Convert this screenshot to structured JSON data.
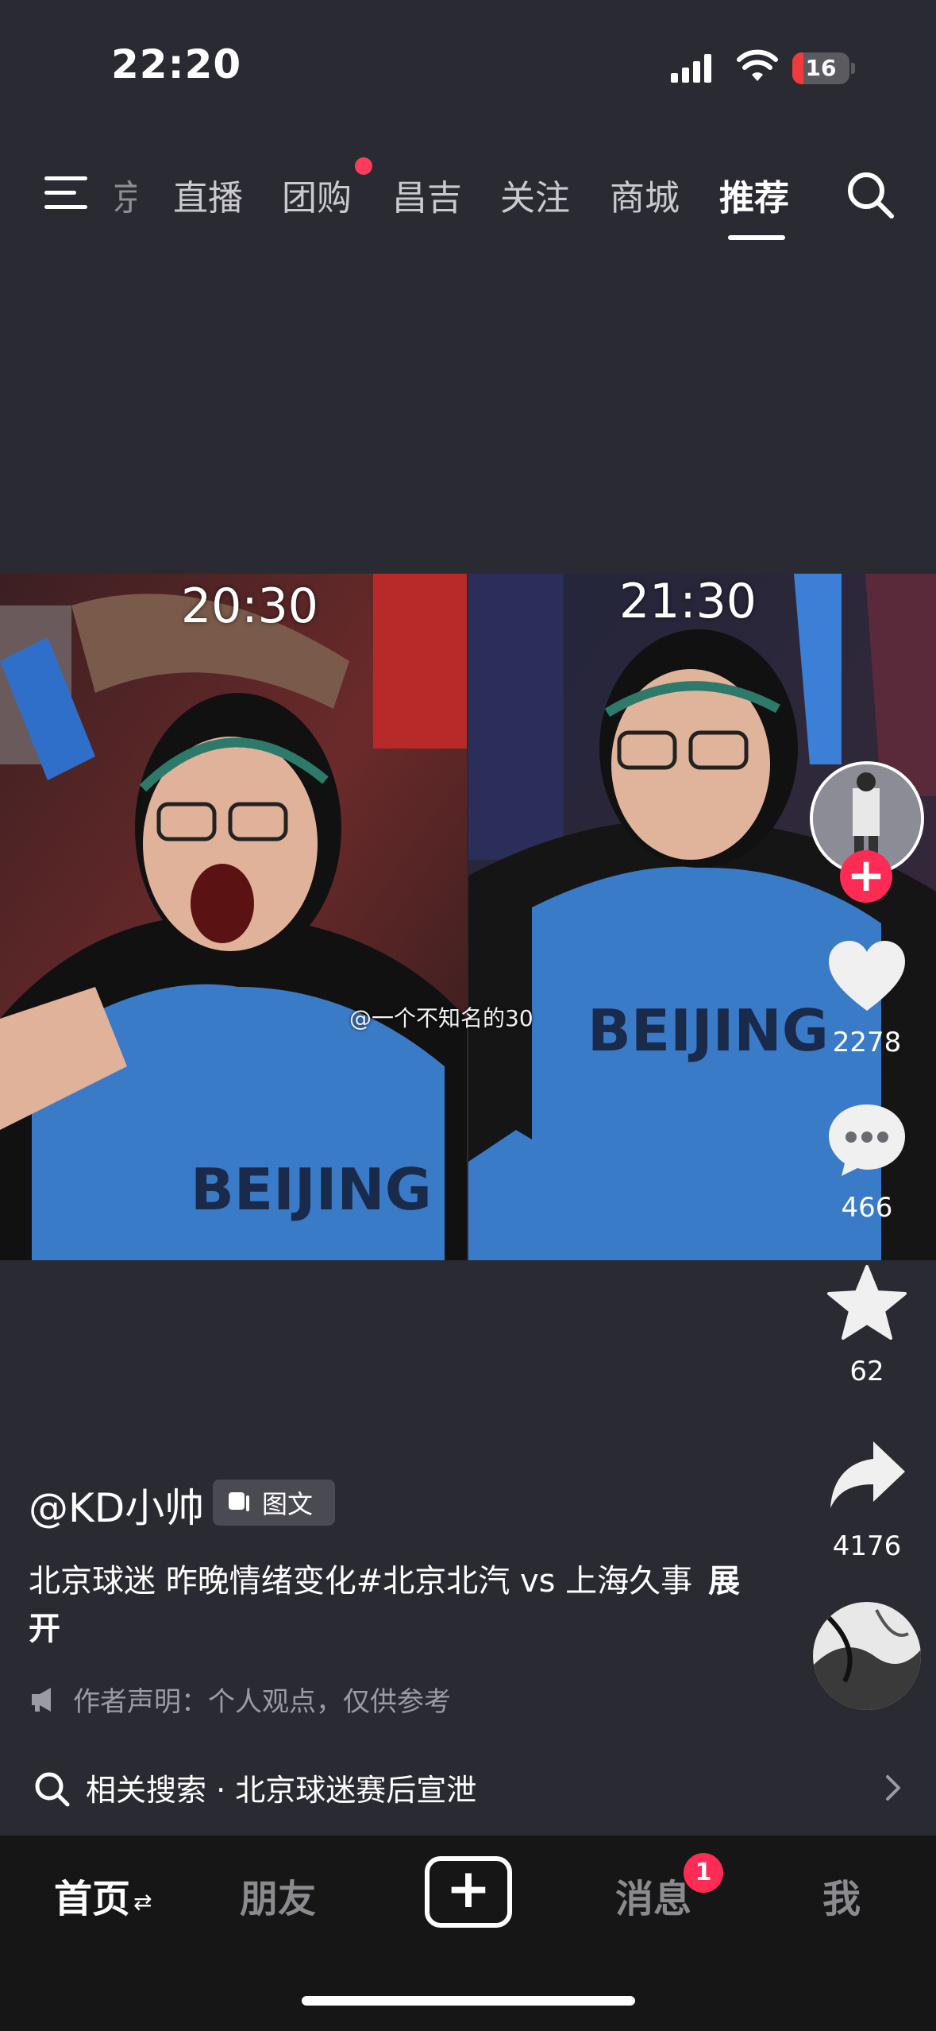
{
  "status_bar": {
    "time": "22:20",
    "battery_level": "16"
  },
  "top_nav": {
    "tabs": [
      {
        "label": "京"
      },
      {
        "label": "直播"
      },
      {
        "label": "团购"
      },
      {
        "label": "昌吉"
      },
      {
        "label": "关注"
      },
      {
        "label": "商城"
      },
      {
        "label": "推荐",
        "active": true
      }
    ]
  },
  "post": {
    "overlay_time_left": "20:30",
    "overlay_time_right": "21:30",
    "watermark": "@一个不知名的30",
    "username": "@KD小帅",
    "type_badge": "图文",
    "caption": "北京球迷 昨晚情绪变化#北京北汽 vs 上海久事",
    "caption_expand": "展开",
    "statement": "作者声明：个人观点，仅供参考",
    "related_search": "相关搜索 · 北京球迷赛后宣泄"
  },
  "rail": {
    "likes": "2278",
    "comments": "466",
    "favorites": "62",
    "shares": "4176"
  },
  "bottom_nav": {
    "home": "首页",
    "friends": "朋友",
    "messages": "消息",
    "message_badge": "1",
    "me": "我"
  },
  "colors": {
    "accent": "#fe2c55",
    "background": "#2a2a33",
    "bottom_bar": "#161616"
  }
}
